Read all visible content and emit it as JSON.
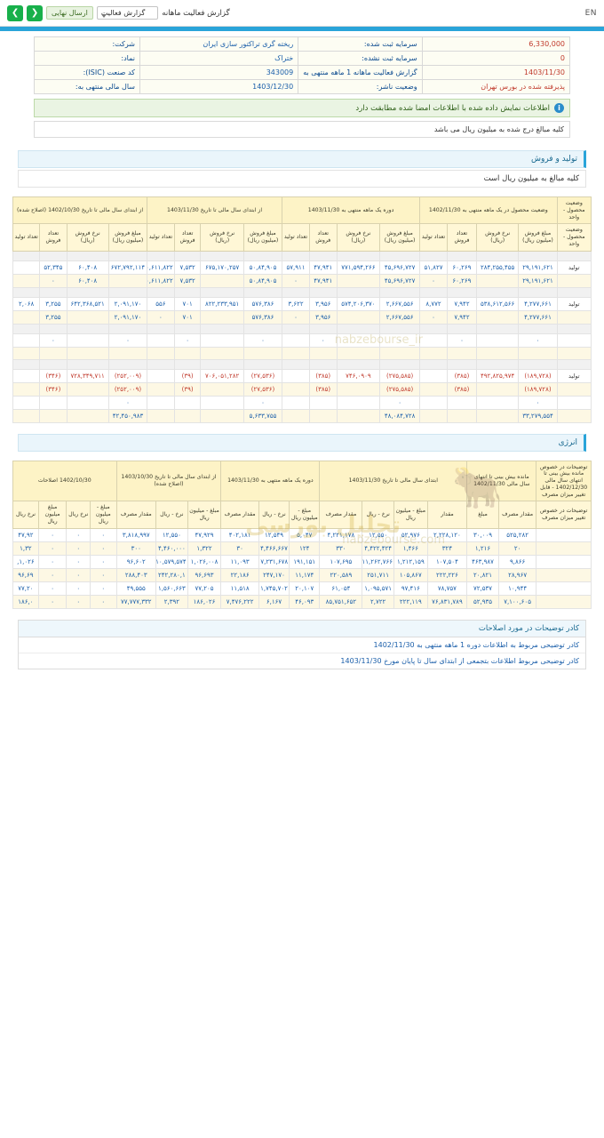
{
  "topbar": {
    "en_label": "EN",
    "prev_icon": "chevron-right-icon",
    "next_icon": "chevron-left-icon",
    "status_pill": "ارسال نهایی",
    "select_value": "گزارش فعالیت",
    "report_label": "گزارش فعالیت ماهانه"
  },
  "header": {
    "company_label": "شرکت:",
    "company_value": "ریخته گری تراکتور سازی ایران",
    "capital_registered_label": "سرمایه ثبت شده:",
    "capital_registered_value": "6,330,000",
    "symbol_label": "نماد:",
    "symbol_value": "ختراک",
    "capital_unregistered_label": "سرمایه ثبت نشده:",
    "capital_unregistered_value": "0",
    "isic_label": "کد صنعت (ISIC):",
    "isic_value": "343009",
    "period_label": "گزارش فعالیت ماهانه 1 ماهه منتهی به",
    "period_value": "1403/11/30",
    "fiscal_year_label": "سال مالی منتهی به:",
    "fiscal_year_value": "1403/12/30",
    "auditor_label": "وضعیت ناشر:",
    "auditor_value": "پذیرفته شده در بورس تهران",
    "notice": "اطلاعات نمایش داده شده با اطلاعات امضا شده مطابقت دارد",
    "notice_icon": "info-icon",
    "amounts_note": "کلیه مبالغ درج شده به میلیون ریال می باشد"
  },
  "sections": {
    "production_sales": "تولید و فروش",
    "production_sales_sub": "کلیه مبالغ به میلیون ریال است",
    "energy": "انرژی"
  },
  "prod_table": {
    "group_headers": [
      "وضعیت محصول - واحد",
      "وضعیت محصول در یک ماهه منتهی به 1402/11/30",
      "دوره یک ماهه منتهی به 1403/11/30",
      "از ابتدای سال مالی تا تاریخ 1403/11/30",
      "از ابتدای سال مالی تا تاریخ 1402/10/30 (اصلاح شده)"
    ],
    "col_headers": [
      "وضعیت محصول - واحد",
      "مبلغ فروش (میلیون ریال)",
      "نرخ فروش (ریال)",
      "تعداد فروش",
      "تعداد تولید",
      "مبلغ فروش (میلیون ریال)",
      "نرخ فروش (ریال)",
      "تعداد فروش",
      "تعداد تولید",
      "مبلغ فروش (میلیون ریال)",
      "نرخ فروش (ریال)",
      "تعداد فروش",
      "تعداد تولید",
      "مبلغ فروش (میلیون ریال)",
      "نرخ فروش (ریال)",
      "تعداد فروش",
      "تعداد تولید"
    ],
    "rows": [
      {
        "type": "blank",
        "cells": [
          "",
          "",
          "",
          "",
          "",
          "",
          "",
          "",
          "",
          "",
          "",
          "",
          "",
          "",
          "",
          "",
          ""
        ]
      },
      {
        "type": "A",
        "cells": [
          "تولید",
          "۲۹,۱۹۱,۶۲۱",
          "۲۸۴,۲۵۵,۴۵۵",
          "۶۰,۲۶۹",
          "۵۱,۸۲۷",
          "۴۵,۶۹۶,۷۲۷",
          "۷۷۱,۵۹۴,۲۶۶",
          "۴۷,۹۴۱",
          "۵۷,۹۱۱",
          "۵۰,۸۴,۹۰۵",
          "۶۷۵,۱۷۰,۲۵۷",
          "۷,۵۳۲",
          "۴۰,۶۱۱,۸۲۲",
          "۶۷۲,۷۹۲,۱۱۴",
          "۶۰,۴۰۸",
          "۵۲,۳۴۵",
          ""
        ]
      },
      {
        "type": "B",
        "cells": [
          "",
          "۲۹,۱۹۱,۶۲۱",
          "",
          "۶۰,۲۶۹",
          "۰",
          "۴۵,۶۹۶,۷۲۷",
          "",
          "۴۷,۹۴۱",
          "۰",
          "۵۰,۸۴,۹۰۵",
          "",
          "۷,۵۳۲",
          "۴۰,۶۱۱,۸۲۲",
          "",
          "۶۰,۴۰۸",
          "۰",
          ""
        ]
      },
      {
        "type": "blank",
        "cells": [
          "",
          "",
          "",
          "",
          "",
          "",
          "",
          "",
          "",
          "",
          "",
          "",
          "",
          "",
          "",
          "",
          ""
        ]
      },
      {
        "type": "A",
        "cells": [
          "تولید",
          "۴,۲۷۷,۶۶۱",
          "۵۳۸,۶۱۲,۵۶۶",
          "۷,۹۴۲",
          "۸,۷۷۲",
          "۲,۶۶۷,۵۵۶",
          "۵۷۴,۲۰۶,۳۷۰",
          "۳,۹۵۶",
          "۳,۶۲۲",
          "۵۷۶,۳۸۶",
          "۸۲۲,۲۳۳,۹۵۱",
          "۷۰۱",
          "۵۵۶",
          "۲,۰۹۱,۱۷۰",
          "۶۴۲,۳۶۸,۵۲۱",
          "۳,۲۵۵",
          "۲,۰۶۸"
        ]
      },
      {
        "type": "B",
        "cells": [
          "",
          "۴,۲۷۷,۶۶۱",
          "",
          "۷,۹۴۲",
          "۰",
          "۲,۶۶۷,۵۵۶",
          "",
          "۳,۹۵۶",
          "۰",
          "۵۷۶,۳۸۶",
          "",
          "۷۰۱",
          "۰",
          "۲,۰۹۱,۱۷۰",
          "",
          "۳,۲۵۵",
          ""
        ]
      },
      {
        "type": "blank",
        "cells": [
          "",
          "",
          "",
          "",
          "",
          "",
          "",
          "",
          "",
          "",
          "",
          "",
          "",
          "",
          "",
          "",
          ""
        ]
      },
      {
        "type": "A",
        "cells": [
          "",
          "۰",
          "",
          "۰",
          "",
          "۰",
          "",
          "۰",
          "",
          "۰",
          "",
          "۰",
          "",
          "۰",
          "",
          "۰",
          ""
        ]
      },
      {
        "type": "B",
        "cells": [
          "",
          "",
          "",
          "",
          "",
          "",
          "",
          "",
          "",
          "",
          "",
          "",
          "",
          "",
          "",
          "",
          ""
        ]
      },
      {
        "type": "blank",
        "cells": [
          "",
          "",
          "",
          "",
          "",
          "",
          "",
          "",
          "",
          "",
          "",
          "",
          "",
          "",
          "",
          "",
          ""
        ]
      },
      {
        "type": "A-neg",
        "cells": [
          "تولید",
          "(۱۸۹,۷۲۸)",
          "۴۹۲,۸۲۵,۹۷۴",
          "(۳۸۵)",
          "",
          "(۲۷۵,۵۸۵)",
          "۷۴۶,۰۹۰۹",
          "(۳۸۵)",
          "",
          "(۲۷,۵۳۶)",
          "۷۰۶,۰۵۱,۲۸۲",
          "(۳۹)",
          "",
          "(۲۵۲,۰۰۹)",
          "۷۲۸,۳۴۹,۷۱۱",
          "(۳۴۶)",
          ""
        ]
      },
      {
        "type": "B-neg",
        "cells": [
          "",
          "(۱۸۹,۷۲۸)",
          "",
          "(۳۸۵)",
          "",
          "(۲۷۵,۵۸۵)",
          "",
          "(۳۸۵)",
          "",
          "(۲۷,۵۳۶)",
          "",
          "(۳۹)",
          "",
          "(۲۵۲,۰۰۹)",
          "",
          "(۳۴۶)",
          ""
        ]
      },
      {
        "type": "A",
        "cells": [
          "",
          "۰",
          "",
          "",
          "",
          "۰",
          "",
          "",
          "",
          "۰",
          "",
          "",
          "",
          "۰",
          "",
          "",
          ""
        ]
      },
      {
        "type": "B",
        "cells": [
          "",
          "۳۳,۲۷۹,۵۵۴",
          "",
          "",
          "",
          "۴۸,۰۸۴,۷۲۸",
          "",
          "",
          "",
          "۵,۶۳۳,۷۵۵",
          "",
          "",
          "",
          "۴۲,۴۵۰,۹۸۳",
          "",
          "",
          ""
        ]
      }
    ]
  },
  "energy_table": {
    "group_headers": [
      "توضیحات در خصوص مانده بیش بینی تا انتهای سال مالی 1402/12/30 - قابل تغییر میزان مصرف",
      "مانده بیش بینی تا انتهای سال مالی 1402/11/30",
      "ابتدای سال مالی تا تاریخ 1403/11/30",
      "دوره یک ماهه منتهی به 1403/11/30",
      "از ابتدای سال مالی تا تاریخ 1403/10/30 (اصلاح شده)",
      "1402/10/30 اصلاحات"
    ],
    "col_headers": [
      "توضیحات در خصوص تغییر میزان مصرف",
      "مقدار مصرف",
      "مبلغ",
      "مقدار",
      "مبلغ - میلیون ریال",
      "نرخ - ریال",
      "مقدار مصرف",
      "مبلغ - میلیون ریال",
      "نرخ - ریال",
      "مقدار مصرف",
      "مبلغ - میلیون ریال",
      "نرخ - ریال",
      "مقدار مصرف",
      "مبلغ - میلیون ریال",
      "نرخ ریال",
      "مبلغ میلیون ریال",
      "نرخ ریال"
    ],
    "rows": [
      {
        "type": "A",
        "cells": [
          "",
          "۵۲۵,۲۸۲",
          "۳۰,۰۰۹",
          "۲,۲۲۸,۱۲۰",
          "۵۲,۹۷۶",
          "۱۲,۵۵۰",
          "۴,۲۲۱,۱۷۸",
          "۵,۰۴۷",
          "۱۲,۵۴۹",
          "۴۰۲,۱۸۱",
          "۴۷,۹۲۹",
          "۱۲,۵۵۰",
          "۳,۸۱۸,۹۹۷",
          "۰",
          "۰",
          "۰",
          "۴۷,۹۲"
        ]
      },
      {
        "type": "B",
        "cells": [
          "",
          "۲۰",
          "۱,۲۱۶",
          "۳۲۴",
          "۱,۴۶۶",
          "۴,۴۲۲,۴۲۴",
          "۳۳۰",
          "۱۲۴",
          "۴,۴۶۶,۶۶۷",
          "۳۰",
          "۱,۳۲۲",
          "۴,۴۶۰,۰۰۰",
          "۳۰۰",
          "۰",
          "۰",
          "۰",
          "۱,۳۲"
        ]
      },
      {
        "type": "A",
        "cells": [
          "",
          "۹,۸۶۶",
          "۴۶۳,۹۸۷",
          "۱۰۷,۵۰۴",
          "۱,۲۱۲,۱۵۹",
          "۱۱,۲۶۲,۷۶۶",
          "۱۰۷,۶۹۵",
          "۱۹۱,۱۵۱",
          "۱۷,۲۳۱,۶۷۸",
          "۱۱,۰۹۳",
          "۱,۰۲۶,۰۰۸",
          "۱۰,۵۷۹,۵۷۴",
          "۹۶,۶۰۲",
          "۰",
          "۰",
          "۰",
          "۱,۰۲۶,"
        ]
      },
      {
        "type": "B",
        "cells": [
          "",
          "۲۸,۹۶۷",
          "۲۰,۸۲۱",
          "۲۲۲,۲۲۶",
          "۱۰۵,۸۶۷",
          "۲۵۱,۷۱۱",
          "۲۲۰,۵۸۹",
          "۱۱,۱۷۴",
          "۲۴۷,۱۷۰",
          "۲۲,۱۸۶",
          "۹۶,۶۹۳",
          "۲۴۲,۲۸۰,۱",
          "۲۸۸,۴۰۳",
          "۰",
          "۰",
          "۰",
          "۹۶,۶۹"
        ]
      },
      {
        "type": "A",
        "cells": [
          "",
          "۱۰,۹۴۴",
          "۷۲,۵۳۷",
          "۷۸,۷۵۷",
          "۹۷,۴۱۶",
          "۱,۰۹۵,۵۷۱",
          "۶۱,۰۵۴",
          "۲۰,۱۰۷",
          "۱,۷۴۵,۷۰۲",
          "۱۱,۵۱۸",
          "۷۷,۲۰۵",
          "۱,۵۶۰,۶۶۳",
          "۴۹,۵۵۵",
          "۰",
          "۰",
          "۰",
          "۷۷,۲۰"
        ]
      },
      {
        "type": "B",
        "cells": [
          "",
          "۷,۱۰۰,۶۰۵",
          "۵۲,۹۳۵",
          "۷۶,۸۳۱,۷۸۹",
          "۲۲۲,۱۱۹",
          "۲,۷۲۲",
          "۸۵,۷۵۱,۶۵۲",
          "۴۶,۰۹۳",
          "۶,۱۶۷",
          "۷,۴۷۶,۲۲۲",
          "۱۸۶,۰۲۶",
          "۲,۳۹۲",
          "۷۷,۷۷۷,۳۳۲",
          "۰",
          "۰",
          "۰",
          "۱۸۶,۰"
        ]
      }
    ]
  },
  "footer": {
    "head": "کادر توضیحات در مورد اصلاحات",
    "rows": [
      "کادر توضیحی مربوط به اطلاعات دوره 1 ماهه منتهی به 1402/11/30",
      "کادر توضیحی مربوط اطلاعات بتجمعی از ابتدای سال تا پایان مورخ 1403/11/30"
    ]
  },
  "watermark": {
    "text_main": "تحلیل بورسی",
    "text_sub": "nabzebourse.com",
    "text_side": "nabzebourse_ir",
    "icon": "bull-icon"
  }
}
